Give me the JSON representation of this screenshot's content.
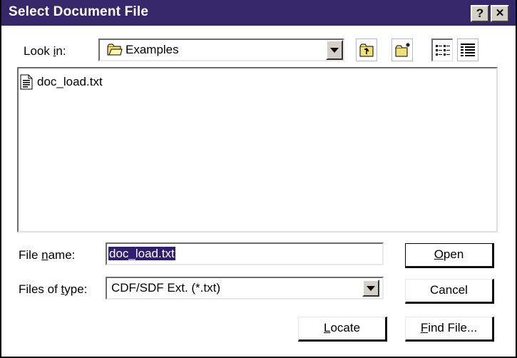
{
  "window": {
    "title": "Select Document File",
    "help_glyph": "?",
    "close_glyph": "✕"
  },
  "look_in": {
    "label_pre": "Look ",
    "label_mnemonic": "i",
    "label_post": "n:",
    "value": "Examples"
  },
  "toolbar": {
    "icons": [
      "up-one-level-icon",
      "create-new-folder-icon",
      "list-view-icon",
      "details-view-icon"
    ]
  },
  "files": [
    {
      "name": "doc_load.txt",
      "icon": "text-file-icon"
    }
  ],
  "file_name": {
    "label_pre": "File ",
    "label_mnemonic": "n",
    "label_post": "ame:",
    "value": "doc_load.txt"
  },
  "file_type": {
    "label_pre": "Files of ",
    "label_mnemonic": "t",
    "label_post": "ype:",
    "value": "CDF/SDF Ext. (*.txt)"
  },
  "buttons": {
    "open_mnemonic": "O",
    "open_rest": "pen",
    "cancel": "Cancel",
    "locate_mnemonic": "L",
    "locate_rest": "ocate",
    "find_mnemonic": "F",
    "find_rest": "ind File..."
  },
  "colors": {
    "titlebar": "#36276a",
    "selection": "#2f1f6e",
    "face": "#d4d0c8"
  }
}
